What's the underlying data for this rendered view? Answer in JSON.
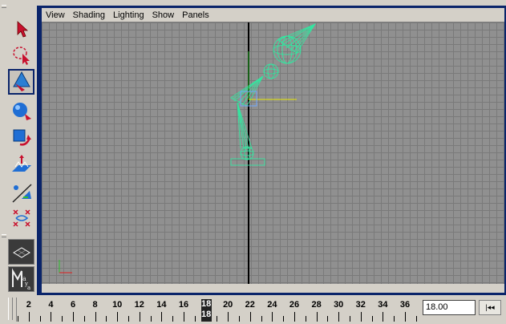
{
  "toolbox": {
    "tools": [
      {
        "name": "select-tool-icon",
        "active": false
      },
      {
        "name": "lasso-tool-icon",
        "active": false
      },
      {
        "name": "paint-selection-tool-icon",
        "active": true
      },
      {
        "name": "move-tool-icon",
        "active": false
      },
      {
        "name": "rotate-tool-icon",
        "active": false
      },
      {
        "name": "scale-tool-icon",
        "active": false
      },
      {
        "name": "soft-modification-tool-icon",
        "active": false
      },
      {
        "name": "show-manipulator-tool-icon",
        "active": false
      },
      {
        "name": "last-tool-used-icon",
        "active": false
      }
    ]
  },
  "panel": {
    "menu": [
      "View",
      "Shading",
      "Lighting",
      "Show",
      "Panels"
    ]
  },
  "timeline": {
    "tick_labels": [
      "2",
      "4",
      "6",
      "8",
      "10",
      "12",
      "14",
      "16",
      "18",
      "20",
      "22",
      "24",
      "26",
      "28",
      "30",
      "32",
      "34",
      "36"
    ],
    "current_frame": "18",
    "current_frame_field": "18.00",
    "rewind_label": "|◂◂"
  },
  "colors": {
    "wireframe": "#33e6a0",
    "panel_border": "#0a246a",
    "grid": "#909090"
  }
}
